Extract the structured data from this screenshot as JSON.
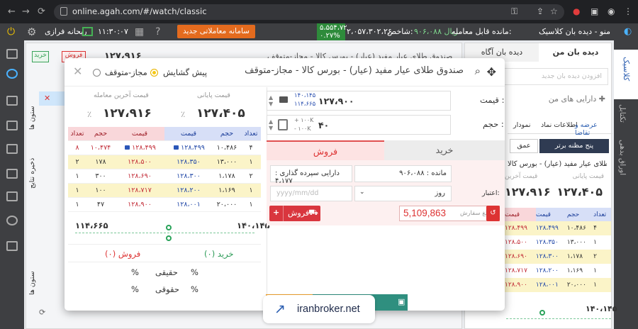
{
  "browser": {
    "url": "online.agah.com/#/watch/classic"
  },
  "appbar": {
    "title": "منو - دیده بان کلاسیک",
    "balance_label": "مانده قابل معامله:",
    "balance": "۹۰۶،۰۸۸ ریال",
    "index_label": "شاخص:",
    "index_value": "۲،۰۵۷،۳۰۲،۲۶",
    "index_change": "۵،۵۵۴،۷۲",
    "index_pct": "۰.۲۷%",
    "new_system": "سامانه معاملاتی جدید",
    "clock": "۱۱:۳۰:۰۷",
    "user": "ریحانه فرازی"
  },
  "right_sidebar": {
    "classic": "کلاسیک",
    "tabular": "تکتابل",
    "bourse": "اوراق بدهی"
  },
  "bg": {
    "tab_watch": "دیده بان من",
    "tab_alert": "دیده بان آگاه",
    "add_watch_placeholder": "افزودن دیده بان جدید",
    "my_assets": "دارایی های من",
    "tabs": [
      "عرضه و تقاضا",
      "اطلاعات نماد",
      "نمودار"
    ],
    "best_five": "پنج مظنه برتر",
    "depth": "عمق",
    "fund_name": "صندوق طلای عیار مفید (عیار) - بورس کالا",
    "last_price_label": "قیمت آخرین",
    "final_price_label": "قیمت پایانی",
    "final_price": "۱۲۷،۴۰۵",
    "last_price": "۱۲۷،۹۱۶",
    "low": "۱۴۰،۱۴۵",
    "sec_title": "صندوق طلای عیار مفید (عیار) - بورس کالا - مجاز-متوقف",
    "buy_label": "خرید",
    "sell_label": "فروش",
    "order_col": "ستون ها",
    "inventory_col": "ذخیره نتایج"
  },
  "modal": {
    "title": "صندوق طلای عیار مفید (عیار) - بورس کالا - مجاز-متوقف",
    "preopen_label": "پیش گشایش",
    "allowed_label": "مجاز-متوقف",
    "final_price_label": "قیمت پایانی",
    "last_trade_label": "قیمت آخرین معامله",
    "final_price": "۱۲۷،۴۰۵",
    "final_pct": "٪",
    "last_price": "۱۲۷،۹۱۶",
    "last_pct": "٪",
    "book_headers": [
      "تعداد",
      "حجم",
      "قیمت",
      "قیمت",
      "حجم",
      "تعداد"
    ],
    "book_rows": [
      [
        "۴",
        "۱۰،۴۸۶",
        "۱۲۸،۴۹۹",
        "۱۲۸،۴۹۹",
        "۱۰،۴۷۴",
        "۸"
      ],
      [
        "۱",
        "۱۳،۰۰۰",
        "۱۲۸،۳۵۰",
        "۱۲۸،۵۰۰",
        "۱۷۸",
        "۲"
      ],
      [
        "۲",
        "۱،۱۷۸",
        "۱۲۸،۳۰۰",
        "۱۲۸،۶۹۰",
        "۳۰۰",
        "۱"
      ],
      [
        "۱",
        "۱،۱۶۹",
        "۱۲۸،۲۰۰",
        "۱۲۸،۷۱۷",
        "۱۰۰",
        "۱"
      ],
      [
        "۱",
        "۲۰،۰۰۰",
        "۱۲۸،۰۰۱",
        "۱۲۸،۹۰۰",
        "۴۷",
        "۱"
      ]
    ],
    "slider_min": "۱۱۴،۶۶۵",
    "slider_max": "۱۴۰،۱۴۵",
    "buy_count": "خرید (۰)",
    "sell_count": "فروش (۰)",
    "real_label": "حقیقی",
    "legal_label": "حقوقی",
    "pct": "%",
    "price_label": "قیمت :",
    "price_value": "۱۲۷،۹۰۰",
    "price_hi": "۱۴۰،۱۴۵",
    "price_lo": "۱۱۴،۶۶۵",
    "volume_label": "حجم :",
    "volume_value": "۴۰",
    "vol_plus": "+ ۱۰۰K",
    "vol_minus": "- ۱۰۰K",
    "tab_buy": "خرید",
    "tab_sell": "فروش",
    "balance_label": "مانده : ۹۰۶،۰۸۸",
    "deposit_label": "دارایی سپرده گذاری : ۴،۱۷۷",
    "validity_label": "اعتبار:",
    "validity_value": "روز",
    "date_placeholder": "yyyy/mm/dd",
    "order_amount_label": "مبلغ سفارش :",
    "order_amount": "5,109,863",
    "sell_button": "فروش"
  },
  "watermark": "iranbroker.net"
}
